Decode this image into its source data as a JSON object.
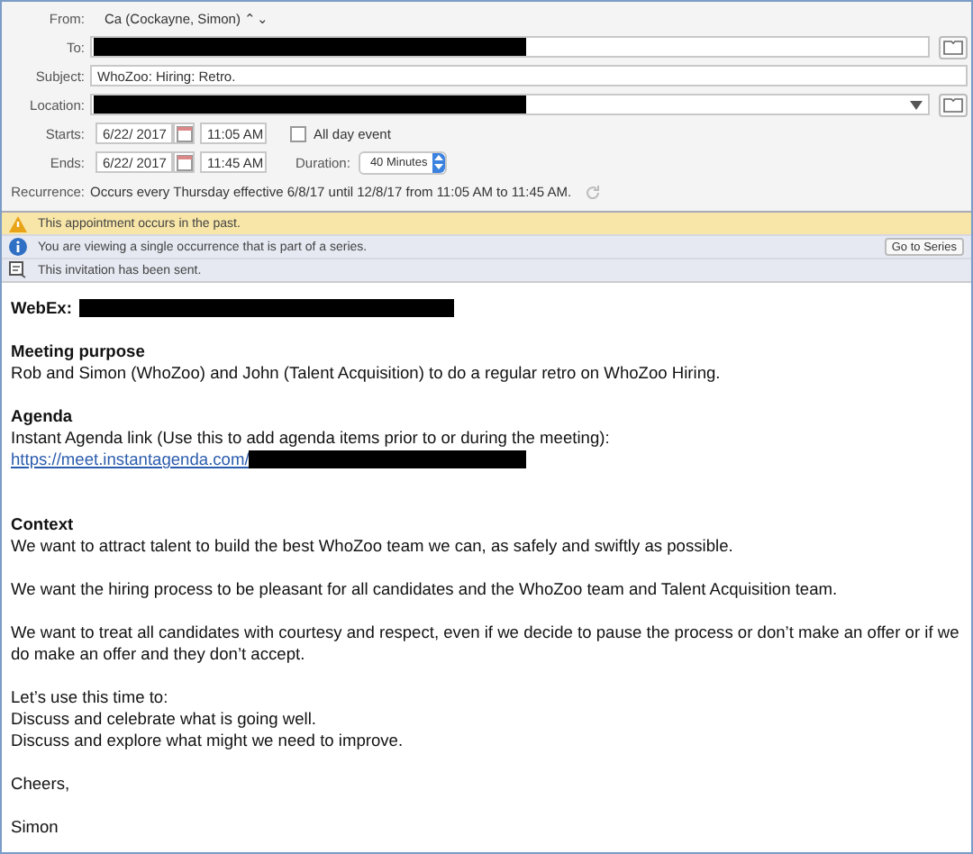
{
  "header": {
    "from": {
      "label": "From:",
      "value": "Ca (Cockayne, Simon) ⌃⌄"
    },
    "to": {
      "label": "To:"
    },
    "subject": {
      "label": "Subject:",
      "value": "WhoZoo: Hiring: Retro."
    },
    "location": {
      "label": "Location:"
    },
    "starts": {
      "label": "Starts:",
      "date": "6/22/ 2017",
      "time": "11:05 AM"
    },
    "all_day": {
      "label": "All day event",
      "checked": false
    },
    "ends": {
      "label": "Ends:",
      "date": "6/22/ 2017",
      "time": "11:45 AM"
    },
    "duration": {
      "label": "Duration:",
      "value": "40 Minutes"
    },
    "recurrence": {
      "label": "Recurrence:",
      "value": "Occurs every Thursday effective 6/8/17 until 12/8/17 from 11:05 AM to 11:45 AM."
    }
  },
  "banners": [
    {
      "kind": "warning",
      "text": "This appointment occurs in the past."
    },
    {
      "kind": "info",
      "text": "You are viewing a single occurrence that is part of a series.",
      "button": "Go to Series"
    },
    {
      "kind": "sent",
      "text": "This invitation has been sent."
    }
  ],
  "body": [
    {
      "kind": "label",
      "text": "WebEx:"
    },
    {
      "kind": "blank"
    },
    {
      "kind": "heading",
      "text": "Meeting purpose"
    },
    {
      "kind": "text",
      "text": "Rob and Simon (WhoZoo) and John (Talent Acquisition) to do a regular retro on WhoZoo Hiring."
    },
    {
      "kind": "blank"
    },
    {
      "kind": "heading",
      "text": "Agenda"
    },
    {
      "kind": "text",
      "text": "Instant Agenda link (Use this to add agenda items prior to or during the meeting):"
    },
    {
      "kind": "link",
      "text": "https://meet.instantagenda.com/"
    },
    {
      "kind": "blank"
    },
    {
      "kind": "blank"
    },
    {
      "kind": "heading",
      "text": "Context"
    },
    {
      "kind": "text",
      "text": "We want to attract talent to build the best WhoZoo team we can, as safely and swiftly as possible."
    },
    {
      "kind": "blank"
    },
    {
      "kind": "text",
      "text": "We want the hiring process to be pleasant for all candidates and the WhoZoo team and Talent Acquisition team."
    },
    {
      "kind": "blank"
    },
    {
      "kind": "text",
      "text": "We want to treat all candidates with courtesy and respect, even if we decide to pause the process or don’t make an offer or if we do make an offer and they don’t accept."
    },
    {
      "kind": "blank"
    },
    {
      "kind": "text",
      "text": "Let’s use this time to:"
    },
    {
      "kind": "text",
      "text": "Discuss and celebrate what is going well."
    },
    {
      "kind": "text",
      "text": "Discuss and explore what might we need to improve."
    },
    {
      "kind": "blank"
    },
    {
      "kind": "text",
      "text": "Cheers,"
    },
    {
      "kind": "blank"
    },
    {
      "kind": "text",
      "text": "Simon"
    }
  ]
}
